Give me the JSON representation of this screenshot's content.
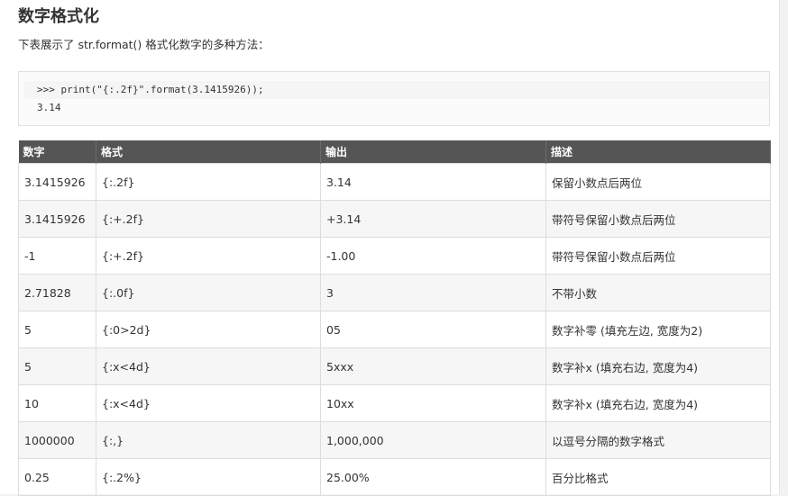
{
  "page": {
    "title": "数字格式化",
    "intro": "下表展示了 str.format() 格式化数字的多种方法："
  },
  "code": {
    "line1": ">>> print(\"{:.2f}\".format(3.1415926));",
    "line2": "3.14"
  },
  "table": {
    "headers": [
      "数字",
      "格式",
      "输出",
      "描述"
    ],
    "rows": [
      [
        "3.1415926",
        "{:.2f}",
        "3.14",
        "保留小数点后两位"
      ],
      [
        "3.1415926",
        "{:+.2f}",
        "+3.14",
        "带符号保留小数点后两位"
      ],
      [
        "-1",
        "{:+.2f}",
        "-1.00",
        "带符号保留小数点后两位"
      ],
      [
        "2.71828",
        "{:.0f}",
        "3",
        "不带小数"
      ],
      [
        "5",
        "{:0>2d}",
        "05",
        "数字补零 (填充左边, 宽度为2)"
      ],
      [
        "5",
        "{:x<4d}",
        "5xxx",
        "数字补x (填充右边, 宽度为4)"
      ],
      [
        "10",
        "{:x<4d}",
        "10xx",
        "数字补x (填充右边, 宽度为4)"
      ],
      [
        "1000000",
        "{:,}",
        "1,000,000",
        "以逗号分隔的数字格式"
      ],
      [
        "0.25",
        "{:.2%}",
        "25.00%",
        "百分比格式"
      ]
    ]
  },
  "colors": {
    "header_bg": "#555555",
    "alt_row_bg": "#f6f6f6",
    "border": "#dddddd"
  }
}
